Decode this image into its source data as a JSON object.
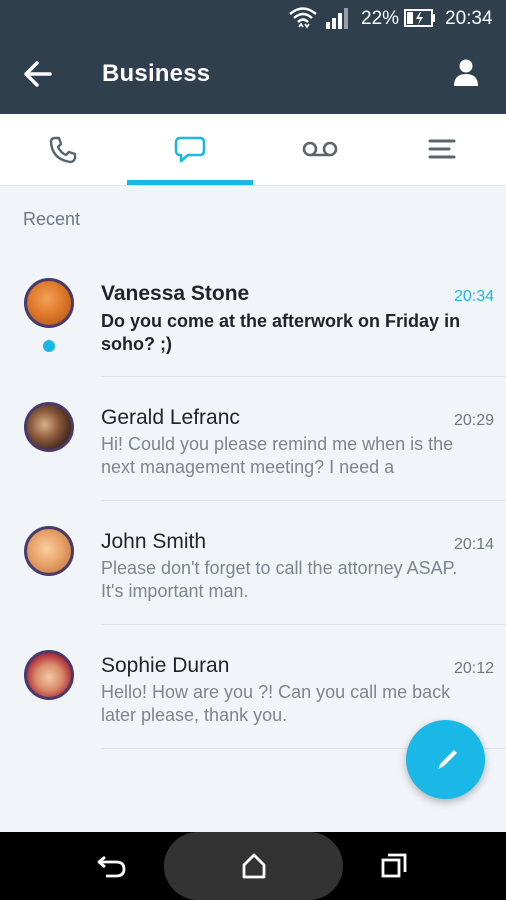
{
  "status_bar": {
    "battery_percent": "22%",
    "time": "20:34"
  },
  "app_bar": {
    "title": "Business"
  },
  "tabs": [
    {
      "id": "calls",
      "icon": "phone-icon",
      "selected": false
    },
    {
      "id": "messages",
      "icon": "chat-bubble-icon",
      "selected": true
    },
    {
      "id": "voicemail",
      "icon": "voicemail-icon",
      "selected": false
    },
    {
      "id": "menu",
      "icon": "list-icon",
      "selected": false
    }
  ],
  "section_label": "Recent",
  "conversations": [
    {
      "name": "Vanessa Stone",
      "time": "20:34",
      "preview_line1": "Do you come at the afterwork on Friday in",
      "preview_line2": "soho? ;)",
      "unread": true
    },
    {
      "name": "Gerald Lefranc",
      "time": "20:29",
      "preview_line1": "Hi! Could you please remind me when is the",
      "preview_line2": "next management meeting? I need a",
      "unread": false
    },
    {
      "name": "John Smith",
      "time": "20:14",
      "preview_line1": "Please don't forget to call the attorney ASAP.",
      "preview_line2": "It's important man.",
      "unread": false
    },
    {
      "name": "Sophie Duran",
      "time": "20:12",
      "preview_line1": "Hello! How are you ?! Can you call me back",
      "preview_line2": "later please, thank you.",
      "unread": false
    }
  ],
  "colors": {
    "accent": "#1ab8e6",
    "app_bar": "#2f3f4d",
    "background": "#f1f5f9"
  }
}
